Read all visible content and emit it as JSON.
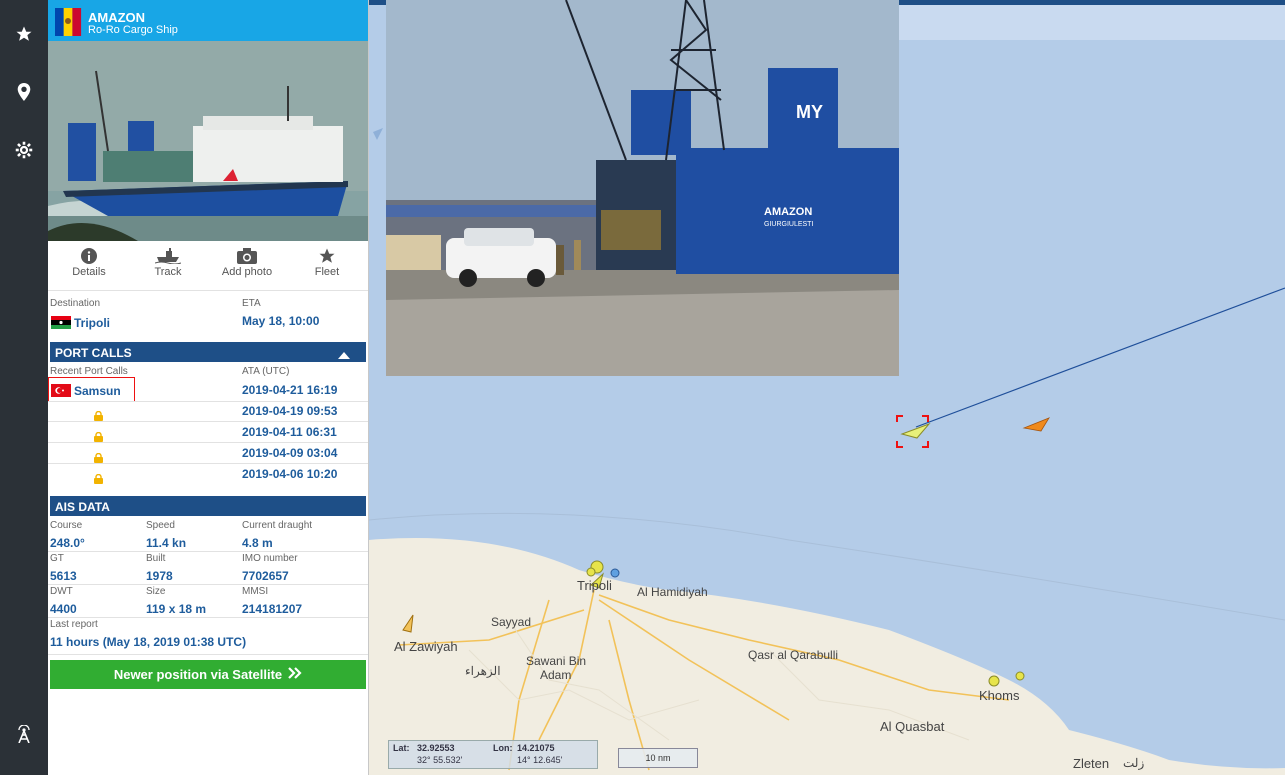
{
  "ship": {
    "name": "AMAZON",
    "type": "Ro-Ro Cargo Ship"
  },
  "actions": [
    {
      "label": "Details",
      "icon": "info-icon"
    },
    {
      "label": "Track",
      "icon": "ship-track-icon"
    },
    {
      "label": "Add photo",
      "icon": "camera-icon"
    },
    {
      "label": "Fleet",
      "icon": "star-icon"
    }
  ],
  "destination": {
    "label": "Destination",
    "value": "Tripoli",
    "flag": "libya-flag-icon"
  },
  "eta": {
    "label": "ETA",
    "value": "May 18, 10:00"
  },
  "port_calls": {
    "title": "PORT CALLS",
    "col_left": "Recent Port Calls",
    "col_right": "ATA (UTC)",
    "rows": [
      {
        "port": "Samsun",
        "flag": "turkey-flag-icon",
        "ata": "2019-04-21 16:19",
        "locked": false
      },
      {
        "port": "",
        "ata": "2019-04-19 09:53",
        "locked": true
      },
      {
        "port": "",
        "ata": "2019-04-11 06:31",
        "locked": true
      },
      {
        "port": "",
        "ata": "2019-04-09 03:04",
        "locked": true
      },
      {
        "port": "",
        "ata": "2019-04-06 10:20",
        "locked": true
      }
    ]
  },
  "ais": {
    "title": "AIS DATA",
    "course_label": "Course",
    "course": "248.0°",
    "speed_label": "Speed",
    "speed": "11.4 kn",
    "draught_label": "Current draught",
    "draught": "4.8 m",
    "gt_label": "GT",
    "gt": "5613",
    "built_label": "Built",
    "built": "1978",
    "imo_label": "IMO number",
    "imo": "7702657",
    "dwt_label": "DWT",
    "dwt": "4400",
    "size_label": "Size",
    "size": "119 x 18 m",
    "mmsi_label": "MMSI",
    "mmsi": "214181207",
    "last_label": "Last report",
    "last": "11 hours (May 18, 2019 01:38 UTC)"
  },
  "satellite_button": "Newer position via Satellite",
  "map": {
    "places": [
      "Tripoli",
      "Al Hamidiyah",
      "Sayyad",
      "Al Zawiyah",
      "Sawani Bin",
      "Adam",
      "الزهراء",
      "Qasr al Qarabulli",
      "Khoms",
      "Al Quasbat",
      "Zleten",
      "زلت"
    ],
    "photo_hull_name": "AMAZON",
    "photo_hull_port": "GIURGIULESTI",
    "photo_funnel": "MY",
    "lat_label": "Lat:",
    "lat": "32.92553",
    "lat_dms": "32° 55.532'",
    "lon_label": "Lon:",
    "lon": "14.21075",
    "lon_dms": "14° 12.645'",
    "scale": "10 nm"
  }
}
